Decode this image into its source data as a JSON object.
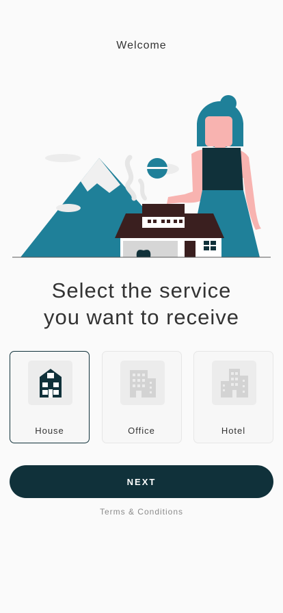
{
  "header": {
    "title": "Welcome"
  },
  "hero": {
    "illustration": "woman-house-mountain-illustration"
  },
  "main": {
    "headline_line1": "Select the service",
    "headline_line2": "you want to receive"
  },
  "options": [
    {
      "label": "House",
      "icon": "house-icon",
      "selected": true
    },
    {
      "label": "Office",
      "icon": "office-building-icon",
      "selected": false
    },
    {
      "label": "Hotel",
      "icon": "hotel-building-icon",
      "selected": false
    }
  ],
  "actions": {
    "next_label": "NEXT",
    "terms_label": "Terms & Conditions"
  },
  "colors": {
    "primary": "#10313a",
    "accent": "#1f8099",
    "background": "#fafafa"
  }
}
